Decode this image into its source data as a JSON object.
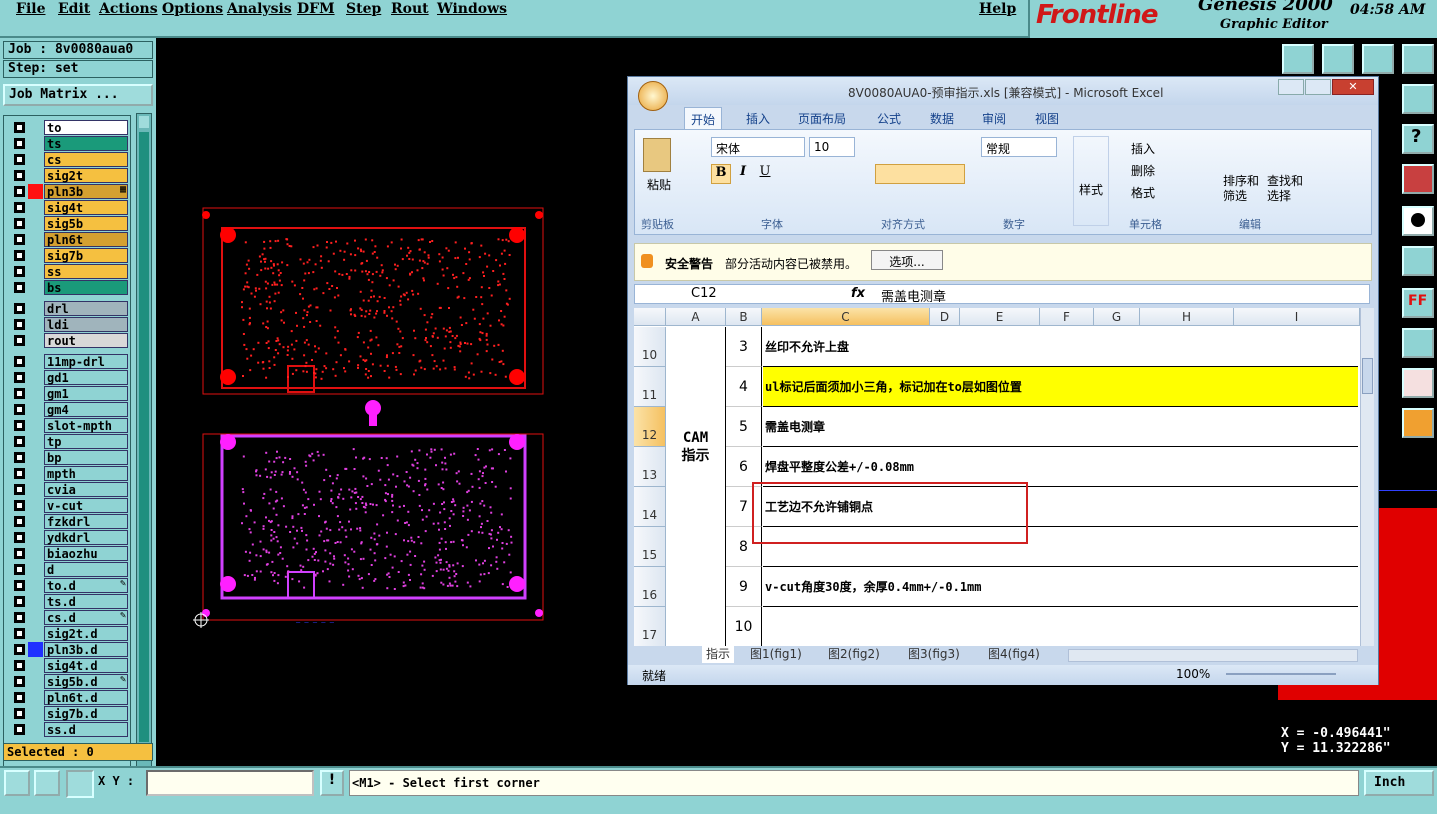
{
  "menubar": {
    "items": [
      "File",
      "Edit",
      "Actions",
      "Options",
      "Analysis",
      "DFM",
      "Step",
      "Rout",
      "Windows"
    ],
    "help": "Help"
  },
  "brand": {
    "logo": "Frontline",
    "product": "Genesis 2000",
    "subtitle": "Graphic Editor",
    "clock": "04:58 AM"
  },
  "left": {
    "job": "Job : 8v0080aua0",
    "step": "Step: set",
    "job_matrix": "Job Matrix ...",
    "selected": "Selected : 0",
    "layers": [
      {
        "name": "to",
        "color": "#ffffff",
        "mark": ""
      },
      {
        "name": "ts",
        "color": "#1a9a7a",
        "mark": ""
      },
      {
        "name": "cs",
        "color": "#f5c040",
        "mark": ""
      },
      {
        "name": "sig2t",
        "color": "#f5c040",
        "mark": ""
      },
      {
        "name": "pln3b",
        "color": "#d4a030",
        "mark": "▦",
        "swatch": "#ff1010",
        "active": true
      },
      {
        "name": "sig4t",
        "color": "#f5c040",
        "mark": ""
      },
      {
        "name": "sig5b",
        "color": "#f5c040",
        "mark": ""
      },
      {
        "name": "pln6t",
        "color": "#d4a030",
        "mark": ""
      },
      {
        "name": "sig7b",
        "color": "#f5c040",
        "mark": ""
      },
      {
        "name": "ss",
        "color": "#f5c040",
        "mark": ""
      },
      {
        "name": "bs",
        "color": "#1a9a7a",
        "mark": ""
      },
      {
        "name": "drl",
        "color": "#a0b4bc",
        "mark": ""
      },
      {
        "name": "ldi",
        "color": "#a0b4bc",
        "mark": ""
      },
      {
        "name": "rout",
        "color": "#d8d8d8",
        "mark": ""
      },
      {
        "name": "11mp-drl",
        "color": "#8fd3d3",
        "mark": ""
      },
      {
        "name": "gd1",
        "color": "#8fd3d3",
        "mark": ""
      },
      {
        "name": "gm1",
        "color": "#8fd3d3",
        "mark": ""
      },
      {
        "name": "gm4",
        "color": "#8fd3d3",
        "mark": ""
      },
      {
        "name": "slot-mpth",
        "color": "#8fd3d3",
        "mark": ""
      },
      {
        "name": "tp",
        "color": "#8fd3d3",
        "mark": ""
      },
      {
        "name": "bp",
        "color": "#8fd3d3",
        "mark": ""
      },
      {
        "name": "mpth",
        "color": "#8fd3d3",
        "mark": ""
      },
      {
        "name": "cvia",
        "color": "#8fd3d3",
        "mark": ""
      },
      {
        "name": "v-cut",
        "color": "#8fd3d3",
        "mark": ""
      },
      {
        "name": "fzkdrl",
        "color": "#8fd3d3",
        "mark": ""
      },
      {
        "name": "ydkdrl",
        "color": "#8fd3d3",
        "mark": ""
      },
      {
        "name": "biaozhu",
        "color": "#8fd3d3",
        "mark": ""
      },
      {
        "name": "d",
        "color": "#8fd3d3",
        "mark": ""
      },
      {
        "name": "to.d",
        "color": "#8fd3d3",
        "mark": "✎"
      },
      {
        "name": "ts.d",
        "color": "#8fd3d3",
        "mark": ""
      },
      {
        "name": "cs.d",
        "color": "#8fd3d3",
        "mark": "✎"
      },
      {
        "name": "sig2t.d",
        "color": "#8fd3d3",
        "mark": ""
      },
      {
        "name": "pln3b.d",
        "color": "#8fd3d3",
        "mark": "",
        "swatch": "#2030ff"
      },
      {
        "name": "sig4t.d",
        "color": "#8fd3d3",
        "mark": ""
      },
      {
        "name": "sig5b.d",
        "color": "#8fd3d3",
        "mark": "✎"
      },
      {
        "name": "pln6t.d",
        "color": "#8fd3d3",
        "mark": ""
      },
      {
        "name": "sig7b.d",
        "color": "#8fd3d3",
        "mark": ""
      },
      {
        "name": "ss.d",
        "color": "#8fd3d3",
        "mark": ""
      }
    ]
  },
  "coords": {
    "x": "X = -0.496441\"",
    "y": "Y = 11.322286\""
  },
  "bottom": {
    "xy_label": "X Y :",
    "xy_value": "",
    "prompt": "<M1> - Select first corner",
    "units": "Inch"
  },
  "excel": {
    "title": "8V0080AUA0-预审指示.xls  [兼容模式] - Microsoft Excel",
    "tabs": [
      "开始",
      "插入",
      "页面布局",
      "公式",
      "数据",
      "审阅",
      "视图"
    ],
    "ribbon": {
      "paste": "粘贴",
      "clipboard": "剪贴板",
      "font_name": "宋体",
      "font_size": "10",
      "font_group": "字体",
      "align_group": "对齐方式",
      "number_format": "常规",
      "number_group": "数字",
      "style": "样式",
      "insert": "插入",
      "delete": "删除",
      "format": "格式",
      "cells_group": "单元格",
      "sort": "排序和\n筛选",
      "find": "查找和\n选择",
      "edit_group": "编辑"
    },
    "security": {
      "label": "安全警告",
      "msg": "部分活动内容已被禁用。",
      "options": "选项..."
    },
    "namebox": "C12",
    "formula": "需盖电测章",
    "columns": [
      "A",
      "B",
      "C",
      "D",
      "E",
      "F",
      "G",
      "H",
      "I"
    ],
    "merged_label": "CAM\n指示",
    "rows": [
      {
        "row": "10",
        "num": "3",
        "text": "丝印不允许上盘",
        "hl": false
      },
      {
        "row": "11",
        "num": "4",
        "text": "ul标记后面须加小三角，标记加在to层如图位置",
        "hl": true
      },
      {
        "row": "12",
        "num": "5",
        "text": "需盖电测章",
        "hl": false
      },
      {
        "row": "13",
        "num": "6",
        "text": "焊盘平整度公差+/-0.08mm",
        "hl": false
      },
      {
        "row": "14",
        "num": "7",
        "text": "工艺边不允许铺铜点",
        "hl": false
      },
      {
        "row": "15",
        "num": "8",
        "text": "",
        "hl": false
      },
      {
        "row": "16",
        "num": "9",
        "text": "v-cut角度30度，余厚0.4mm+/-0.1mm",
        "hl": false
      },
      {
        "row": "17",
        "num": "10",
        "text": "",
        "hl": false
      }
    ],
    "sheets": [
      "指示",
      "图1(fig1)",
      "图2(fig2)",
      "图3(fig3)",
      "图4(fig4)"
    ],
    "status": "就绪",
    "zoom": "100%"
  }
}
